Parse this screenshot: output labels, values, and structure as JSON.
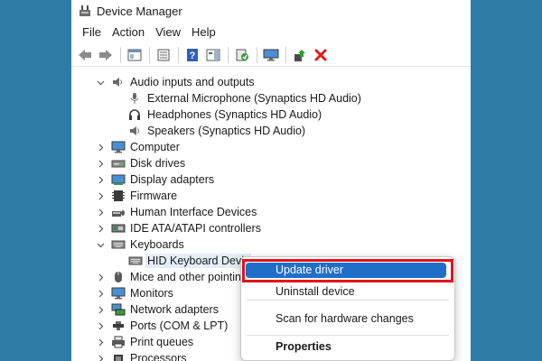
{
  "window": {
    "title": "Device Manager"
  },
  "menu": [
    "File",
    "Action",
    "View",
    "Help"
  ],
  "colors": {
    "background": "#2e7ba6",
    "highlight": "#1f6fc9",
    "callout": "#e0141e"
  },
  "tree": [
    {
      "label": "Audio inputs and outputs",
      "icon": "speaker-icon",
      "expanded": true
    },
    {
      "label": "External Microphone (Synaptics HD Audio)",
      "icon": "microphone-icon"
    },
    {
      "label": "Headphones (Synaptics HD Audio)",
      "icon": "headphones-icon"
    },
    {
      "label": "Speakers (Synaptics HD Audio)",
      "icon": "speaker-icon"
    },
    {
      "label": "Computer",
      "icon": "monitor-icon",
      "expanded": false
    },
    {
      "label": "Disk drives",
      "icon": "disk-drive-icon",
      "expanded": false
    },
    {
      "label": "Display adapters",
      "icon": "display-adapter-icon",
      "expanded": false
    },
    {
      "label": "Firmware",
      "icon": "firmware-icon",
      "expanded": false
    },
    {
      "label": "Human Interface Devices",
      "icon": "hid-icon",
      "expanded": false
    },
    {
      "label": "IDE ATA/ATAPI controllers",
      "icon": "ide-controller-icon",
      "expanded": false
    },
    {
      "label": "Keyboards",
      "icon": "keyboard-icon",
      "expanded": true
    },
    {
      "label": "HID Keyboard Devic",
      "icon": "keyboard-icon",
      "selected": true
    },
    {
      "label": "Mice and other pointing",
      "icon": "mouse-icon",
      "expanded": false
    },
    {
      "label": "Monitors",
      "icon": "monitor-icon",
      "expanded": false
    },
    {
      "label": "Network adapters",
      "icon": "network-icon",
      "expanded": false
    },
    {
      "label": "Ports (COM & LPT)",
      "icon": "port-icon",
      "expanded": false
    },
    {
      "label": "Print queues",
      "icon": "printer-icon",
      "expanded": false
    },
    {
      "label": "Processors",
      "icon": "processor-icon",
      "expanded": false
    }
  ],
  "context_menu": {
    "update_driver": "Update driver",
    "uninstall_device": "Uninstall device",
    "scan_changes": "Scan for hardware changes",
    "properties": "Properties"
  }
}
